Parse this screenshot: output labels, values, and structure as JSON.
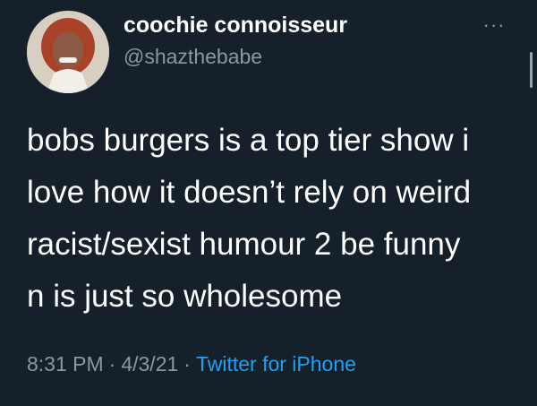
{
  "user": {
    "display_name": "coochie connoisseur",
    "handle": "@shazthebabe"
  },
  "more_icon": "···",
  "tweet": {
    "lines": [
      "bobs burgers is a top tier show i",
      "love how it doesn’t rely on weird",
      "racist/sexist humour 2 be funny",
      "n is just so wholesome"
    ]
  },
  "meta": {
    "time": "8:31 PM",
    "separator": "·",
    "date": "4/3/21",
    "source": "Twitter for iPhone"
  },
  "colors": {
    "background": "#15202b",
    "primary_text": "#ffffff",
    "secondary_text": "#8899a6",
    "link": "#1da1f2"
  }
}
